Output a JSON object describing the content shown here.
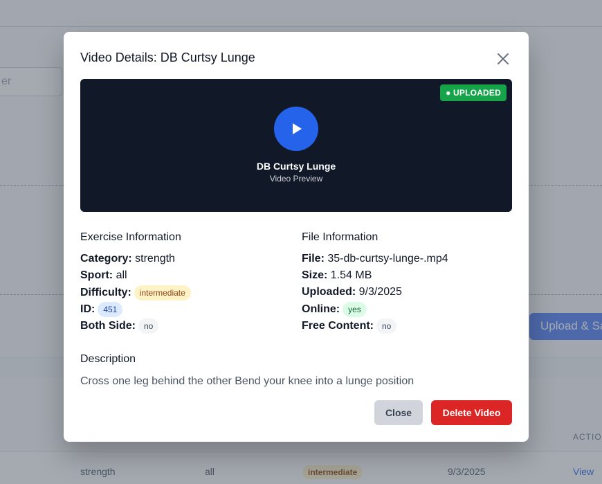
{
  "background": {
    "search_placeholder": "er",
    "upload_button": "Upload & Sa",
    "table": {
      "actions_header": "ACTIONS",
      "row": {
        "category": "strength",
        "sport": "all",
        "difficulty": "intermediate",
        "uploaded": "9/3/2025",
        "view_link": "View"
      }
    }
  },
  "modal": {
    "title": "Video Details: DB Curtsy Lunge",
    "close_icon": "close-icon",
    "video": {
      "status_badge": "● UPLOADED",
      "play_icon": "play-icon",
      "title": "DB Curtsy Lunge",
      "subtitle": "Video Preview"
    },
    "exercise_info": {
      "heading": "Exercise Information",
      "category_label": "Category:",
      "category_value": "strength",
      "sport_label": "Sport:",
      "sport_value": "all",
      "difficulty_label": "Difficulty:",
      "difficulty_value": "intermediate",
      "id_label": "ID:",
      "id_value": "451",
      "both_side_label": "Both Side:",
      "both_side_value": "no"
    },
    "file_info": {
      "heading": "File Information",
      "file_label": "File:",
      "file_value": "35-db-curtsy-lunge-.mp4",
      "size_label": "Size:",
      "size_value": "1.54 MB",
      "uploaded_label": "Uploaded:",
      "uploaded_value": "9/3/2025",
      "online_label": "Online:",
      "online_value": "yes",
      "free_content_label": "Free Content:",
      "free_content_value": "no"
    },
    "description": {
      "heading": "Description",
      "text": "Cross one leg behind the other Bend your knee into a lunge position"
    },
    "buttons": {
      "close": "Close",
      "delete": "Delete Video"
    }
  },
  "colors": {
    "primary": "#2563eb",
    "success": "#16a34a",
    "danger": "#dc2626",
    "video_bg": "#111827"
  }
}
